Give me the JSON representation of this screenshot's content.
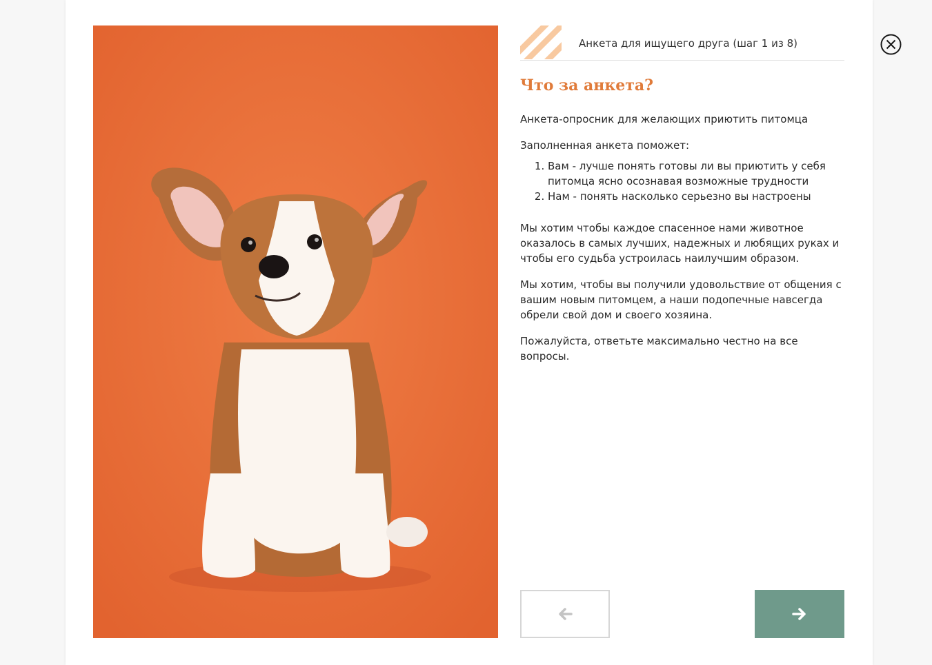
{
  "header": {
    "step_text": "Анкета для ищущего друга (шаг 1 из 8)"
  },
  "content": {
    "title": "Что за анкета?",
    "intro": "Анкета-опросник для желающих приютить питомца",
    "helps_label": "Заполненная анкета поможет:",
    "helps_items": [
      "Вам - лучше понять готовы ли вы приютить у себя питомца ясно осознавая возможные трудности",
      "Нам - понять насколько серьезно вы настроены"
    ],
    "paragraph_1": "Мы хотим чтобы каждое спасенное нами животное оказалось в самых лучших, надежных и любящих руках и чтобы его судьба устроилась наилучшим образом.",
    "paragraph_2": "Мы хотим, чтобы вы получили удовольствие от общения с вашим новым питомцем, а наши подопечные навсегда обрели свой дом и своего хозяина.",
    "paragraph_3": "Пожалуйста, ответьте максимально честно на все вопросы."
  },
  "icons": {
    "close": "close-circle-icon",
    "prev": "arrow-left-icon",
    "next": "arrow-right-icon",
    "header_decor": "diagonal-stripes"
  },
  "colors": {
    "accent_orange": "#e07b3a",
    "stripe_peach": "#f8c9a0",
    "photo_background": "#e8703a",
    "next_button": "#6f9a8b",
    "prev_button_border": "#d6d6d6"
  }
}
